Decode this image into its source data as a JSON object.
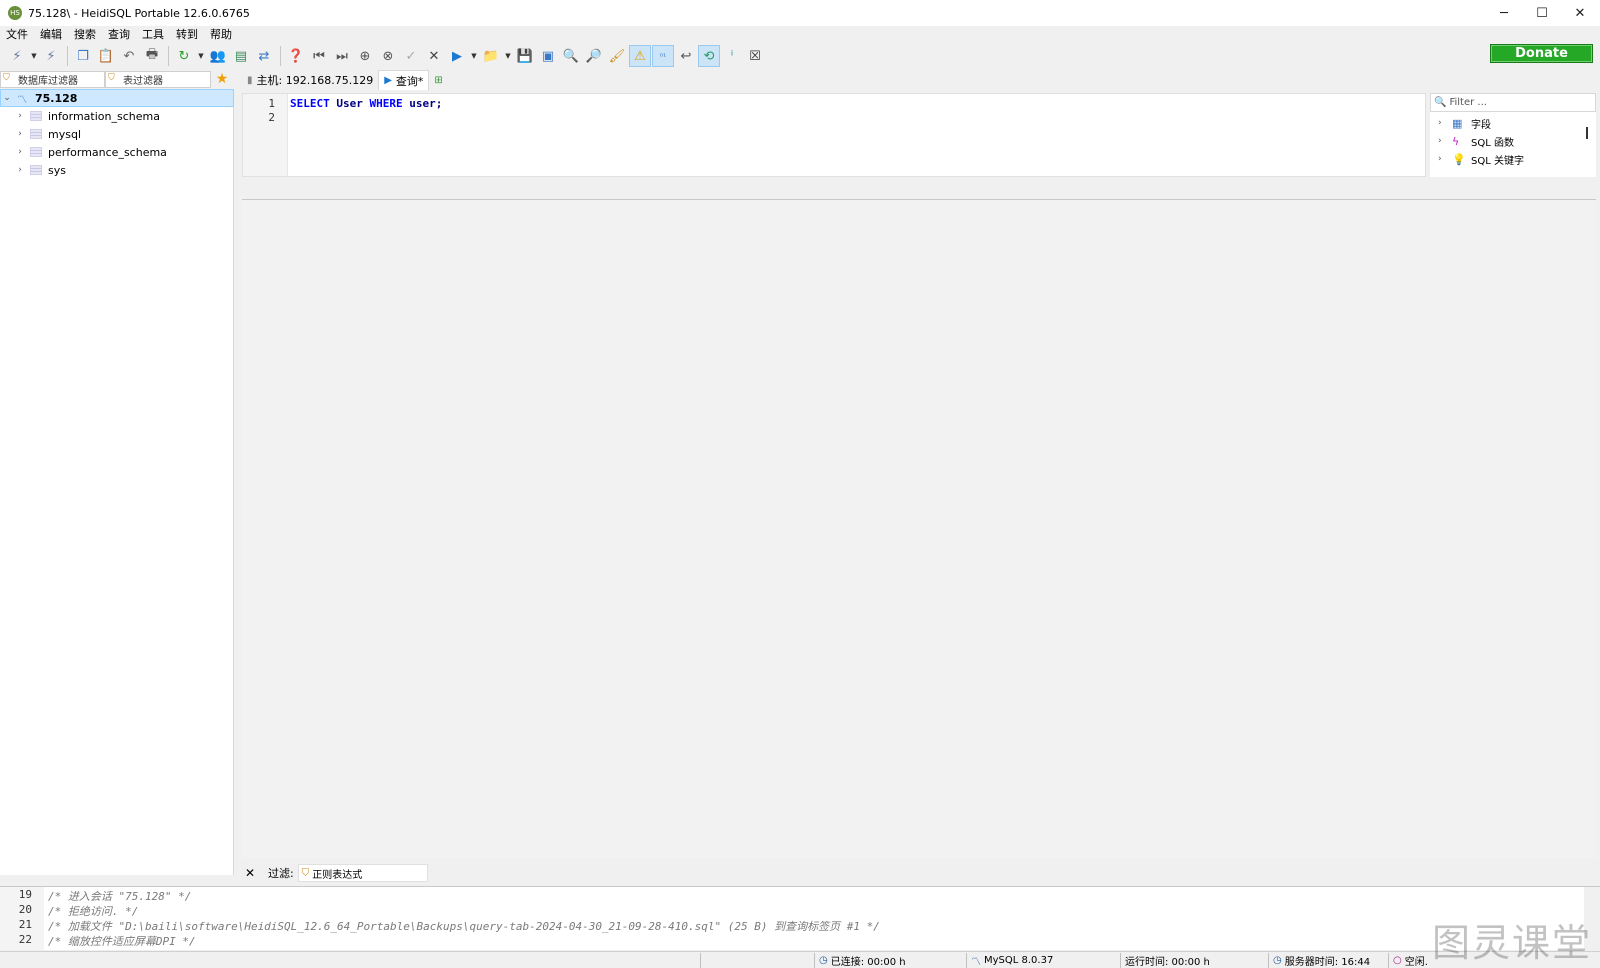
{
  "window": {
    "title": "75.128\\ - HeidiSQL Portable 12.6.0.6765",
    "minimize": "─",
    "maximize": "☐",
    "close": "✕"
  },
  "menu": [
    "文件",
    "编辑",
    "搜索",
    "查询",
    "工具",
    "转到",
    "帮助"
  ],
  "donate": "Donate",
  "left_filters": {
    "db_filter": "数据库过滤器",
    "table_filter": "表过滤器"
  },
  "tree": {
    "server": "75.128",
    "databases": [
      "information_schema",
      "mysql",
      "performance_schema",
      "sys"
    ]
  },
  "tabs": {
    "host": "主机: 192.168.75.129",
    "query": "查询*"
  },
  "editor": {
    "line_numbers": [
      "1",
      "2"
    ],
    "line1": {
      "kw1": "SELECT",
      "id1": "User",
      "kw2": "WHERE",
      "id2": "user",
      "end": ";"
    }
  },
  "helper": {
    "filter_placeholder": "Filter ...",
    "items": [
      "字段",
      "SQL 函数",
      "SQL 关键字"
    ]
  },
  "result_filter": {
    "label": "过滤:",
    "placeholder": "正则表达式"
  },
  "log": [
    {
      "n": "19",
      "text": "/* 进入会话 \"75.128\" */"
    },
    {
      "n": "20",
      "text": "/* 拒绝访问. */"
    },
    {
      "n": "21",
      "text": "/* 加载文件 \"D:\\baili\\software\\HeidiSQL_12.6_64_Portable\\Backups\\query-tab-2024-04-30_21-09-28-410.sql\" (25 B) 到查询标签页 #1 */"
    },
    {
      "n": "22",
      "text": "/* 缩放控件适应屏幕DPI */"
    }
  ],
  "status": {
    "connected": "已连接: 00:00 h",
    "mysql": "MySQL 8.0.37",
    "uptime": "运行时间: 00:00 h",
    "server_time": "服务器时间: 16:44",
    "idle": "空闲."
  },
  "watermark": "图灵课堂"
}
